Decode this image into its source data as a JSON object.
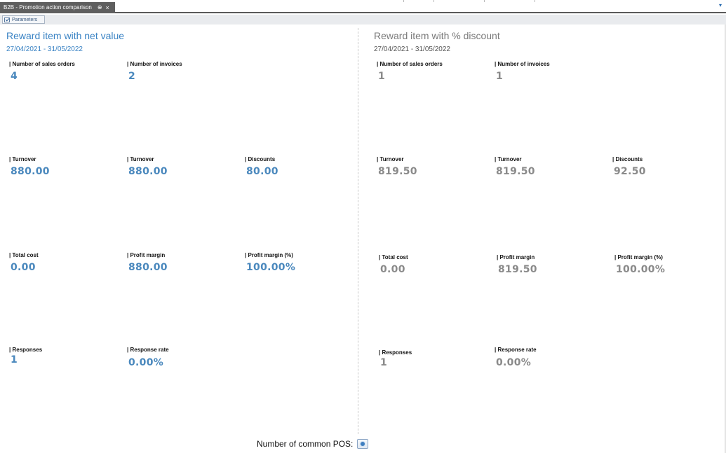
{
  "tab": {
    "label": "B2B - Promotion action comparison",
    "pin_glyph": "⊕",
    "close_glyph": "×",
    "menu_glyph": "▾"
  },
  "toolbar": {
    "parameters_label": "Parameters"
  },
  "left": {
    "title": "Reward item with net value",
    "date_range": "27/04/2021 - 31/05/2022",
    "color": "#3a83c4",
    "metrics": {
      "sales_orders": {
        "label": "Number of sales orders",
        "value": "4"
      },
      "invoices": {
        "label": "Number of invoices",
        "value": "2"
      },
      "turnover_1": {
        "label": "Turnover",
        "value": "880.00"
      },
      "turnover_2": {
        "label": "Turnover",
        "value": "880.00"
      },
      "discounts": {
        "label": "Discounts",
        "value": "80.00"
      },
      "total_cost": {
        "label": "Total cost",
        "value": "0.00"
      },
      "profit_margin": {
        "label": "Profit margin",
        "value": "880.00"
      },
      "profit_margin_pct": {
        "label": "Profit margin (%)",
        "value": "100.00%"
      },
      "responses": {
        "label": "Responses",
        "value": "1"
      },
      "response_rate": {
        "label": "Response rate",
        "value": "0.00%"
      }
    }
  },
  "right": {
    "title": "Reward item with % discount",
    "date_range": "27/04/2021 - 31/05/2022",
    "color": "#7a7a7a",
    "metrics": {
      "sales_orders": {
        "label": "Number of sales orders",
        "value": "1"
      },
      "invoices": {
        "label": "Number of invoices",
        "value": "1"
      },
      "turnover_1": {
        "label": "Turnover",
        "value": "819.50"
      },
      "turnover_2": {
        "label": "Turnover",
        "value": "819.50"
      },
      "discounts": {
        "label": "Discounts",
        "value": "92.50"
      },
      "total_cost": {
        "label": "Total cost",
        "value": "0.00"
      },
      "profit_margin": {
        "label": "Profit margin",
        "value": "819.50"
      },
      "profit_margin_pct": {
        "label": "Profit margin (%)",
        "value": "100.00%"
      },
      "responses": {
        "label": "Responses",
        "value": "1"
      },
      "response_rate": {
        "label": "Response rate",
        "value": "0.00%"
      }
    }
  },
  "footer": {
    "common_pos_label": "Number of common POS:"
  }
}
